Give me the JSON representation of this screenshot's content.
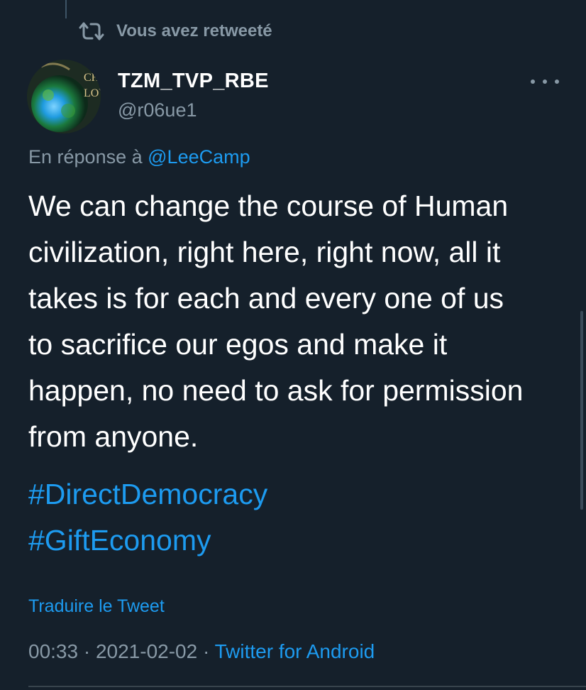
{
  "retweet": {
    "label": "Vous avez retweeté",
    "icon": "retweet-icon"
  },
  "author": {
    "display_name": "TZM_TVP_RBE",
    "handle": "@r06ue1",
    "avatar_text": [
      "CH",
      "LOV"
    ]
  },
  "reply": {
    "prefix": "En réponse à",
    "mention": "@LeeCamp"
  },
  "tweet": {
    "text_lines": [
      "We can change the course of Human",
      "civilization, right here, right now, all it",
      "takes is for each and every one of us",
      "to sacrifice our egos and make it",
      "happen, no need to ask for permission",
      "from anyone."
    ],
    "hashtags": [
      "#DirectDemocracy",
      "#GiftEconomy"
    ]
  },
  "translate_label": "Traduire le Tweet",
  "meta": {
    "time": "00:33",
    "separator": " · ",
    "date": "2021-02-02",
    "source": "Twitter for Android"
  },
  "colors": {
    "background": "#15202b",
    "text": "#ffffff",
    "secondary": "#8899a6",
    "link": "#1d9bf0"
  }
}
